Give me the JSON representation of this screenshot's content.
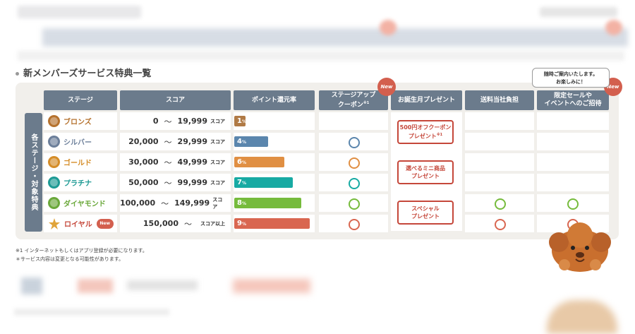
{
  "section_title": "新メンバーズサービス特典一覧",
  "side_label": "各ステージ・対象特典",
  "headers": {
    "stage": "ステージ",
    "score": "スコア",
    "point_rate": "ポイント還元率",
    "stage_up_coupon": "ステージアップ",
    "stage_up_coupon_2": "クーポン",
    "stage_up_note": "※1",
    "birthday": "お誕生月プレゼント",
    "shipping": "送料当社負担",
    "sale_1": "限定セールや",
    "sale_2": "イベントへのご招待"
  },
  "new_badge": "New",
  "bubble": {
    "line1": "随時ご案内いたします。",
    "line2": "お楽しみに！"
  },
  "stages": [
    {
      "name": "ブロンズ",
      "color": "#b5722e",
      "from": "0",
      "to": "19,999",
      "unit": "スコア",
      "rate": "1",
      "rate_unit": "%",
      "rate_pct": 1,
      "bar_color": "#b07a45",
      "coupon": false,
      "shipping": false,
      "sale": false
    },
    {
      "name": "シルバー",
      "color": "#6c7f9a",
      "from": "20,000",
      "to": "29,999",
      "unit": "スコア",
      "rate": "4",
      "rate_unit": "%",
      "rate_pct": 4,
      "bar_color": "#5b86ad",
      "coupon": true,
      "coupon_color": "#5b86ad",
      "shipping": false,
      "sale": false
    },
    {
      "name": "ゴールド",
      "color": "#d58d28",
      "from": "30,000",
      "to": "49,999",
      "unit": "スコア",
      "rate": "6",
      "rate_unit": "%",
      "rate_pct": 6,
      "bar_color": "#e08f43",
      "coupon": true,
      "coupon_color": "#e08f43",
      "shipping": false,
      "sale": false
    },
    {
      "name": "プラチナ",
      "color": "#1d9a94",
      "from": "50,000",
      "to": "99,999",
      "unit": "スコア",
      "rate": "7",
      "rate_unit": "%",
      "rate_pct": 7,
      "bar_color": "#17aaa3",
      "coupon": true,
      "coupon_color": "#17aaa3",
      "shipping": false,
      "sale": false
    },
    {
      "name": "ダイヤモンド",
      "color": "#6aa83a",
      "from": "100,000",
      "to": "149,999",
      "unit": "スコア",
      "rate": "8",
      "rate_unit": "%",
      "rate_pct": 8,
      "bar_color": "#76bb3c",
      "coupon": true,
      "coupon_color": "#76bb3c",
      "shipping": true,
      "shipping_color": "#76bb3c",
      "sale": true,
      "sale_color": "#76bb3c"
    },
    {
      "name": "ロイヤル",
      "color": "#c5473a",
      "from": "150,000",
      "to": "",
      "unit": "スコア以上",
      "rate": "9",
      "rate_unit": "%",
      "rate_pct": 9,
      "bar_color": "#d96650",
      "coupon": true,
      "coupon_color": "#d96650",
      "shipping": true,
      "shipping_color": "#d96650",
      "sale": true,
      "sale_color": "#d96650",
      "is_new": true
    }
  ],
  "tilde": "～",
  "presents": [
    {
      "line1": "500円オフクーポン",
      "line2": "プレゼント",
      "note": "※1"
    },
    {
      "line1": "選べるミニ商品",
      "line2": "プレゼント",
      "note": ""
    },
    {
      "line1": "スペシャル",
      "line2": "プレゼント",
      "note": ""
    }
  ],
  "footnotes": [
    "※1 インターネットもしくはアプリ登録が必要になります。",
    "＊サービス内容は変更となる可能性があります。"
  ]
}
